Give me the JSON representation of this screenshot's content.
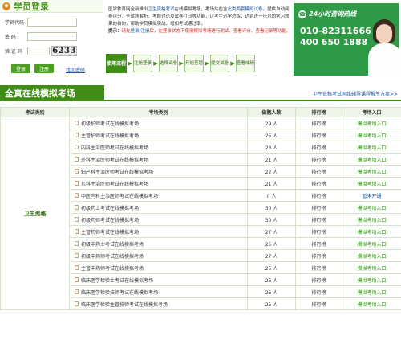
{
  "login": {
    "title": "学员登录",
    "code_label": "学员代码",
    "password_label": "密  码",
    "captcha_label": "验 证 码",
    "captcha_text": "6233",
    "login_button": "登录",
    "register_button": "注册",
    "forgot_link": "找回密码"
  },
  "intro": {
    "p1_a": "医学教育网全新推出",
    "p1_link": "卫生资格考试",
    "p1_b": "在线模拟考场，考场共包含",
    "p1_link2": "此类两套模拟试卷",
    "p1_c": "。提供自动阅卷评分、全试题解析、考题讨论及试卷打印等功能，让考生迅学边练，达到进一步巩固学习效果的目的，帮助学员模拟实战，增加考试通过率。",
    "tip_label": "提示：",
    "tip_a": "请先",
    "tip_link": "登录/注册",
    "tip_b": "后，在登录状态下使用模拟考场进行测试、查看评分、",
    "tip_c": "查看记录等功能。"
  },
  "flow": {
    "head": "使用流程",
    "steps": [
      "注册登录",
      "选择试卷",
      "开始答题",
      "提交试卷",
      "查看成绩"
    ],
    "arrow": "▶"
  },
  "hotline": {
    "phone_icon": "☎",
    "title": "24小时咨询热线",
    "number1": "010-82311666",
    "number2": "400 650 1888"
  },
  "section": {
    "title": "全真在线模拟考场",
    "more": "卫生资格考试网络辅导课程报生方案>>"
  },
  "table": {
    "headers": [
      "考试类别",
      "考场类别",
      "做题人数",
      "排行榜",
      "考场入口"
    ],
    "category": "卫生资格",
    "rows": [
      {
        "name": "初级护师考试在线模拟考场",
        "count": "29 人",
        "rank": "排行榜",
        "entry": "模拟考场入口"
      },
      {
        "name": "主管护师考试在线模拟考场",
        "count": "25 人",
        "rank": "排行榜",
        "entry": "模拟考场入口"
      },
      {
        "name": "内科主治医师考试在线模拟考场",
        "count": "23 人",
        "rank": "排行榜",
        "entry": "模拟考场入口"
      },
      {
        "name": "外科主治医师考试在线模拟考场",
        "count": "21 人",
        "rank": "排行榜",
        "entry": "模拟考场入口"
      },
      {
        "name": "妇产科主治医师考试在线模拟考场",
        "count": "22 人",
        "rank": "排行榜",
        "entry": "模拟考场入口"
      },
      {
        "name": "儿科主治医师考试在线模拟考场",
        "count": "21 人",
        "rank": "排行榜",
        "entry": "模拟考场入口"
      },
      {
        "name": "中医内科主治医师考试在线模拟考场",
        "count": "0 人",
        "rank": "排行榜",
        "entry": "暂未开通"
      },
      {
        "name": "初级药士考试在线模拟考场",
        "count": "30 人",
        "rank": "排行榜",
        "entry": "模拟考场入口"
      },
      {
        "name": "初级药师考试在线模拟考场",
        "count": "30 人",
        "rank": "排行榜",
        "entry": "模拟考场入口"
      },
      {
        "name": "主管药师考试在线模拟考场",
        "count": "27 人",
        "rank": "排行榜",
        "entry": "模拟考场入口"
      },
      {
        "name": "初级中药士考试在线模拟考场",
        "count": "25 人",
        "rank": "排行榜",
        "entry": "模拟考场入口"
      },
      {
        "name": "初级中药师考试在线模拟考场",
        "count": "27 人",
        "rank": "排行榜",
        "entry": "模拟考场入口"
      },
      {
        "name": "主管中药师考试在线模拟考场",
        "count": "25 人",
        "rank": "排行榜",
        "entry": "模拟考场入口"
      },
      {
        "name": "临床医学检验士考试在线模拟考场",
        "count": "25 人",
        "rank": "排行榜",
        "entry": "模拟考场入口"
      },
      {
        "name": "临床医学检验技师考试在线模拟考场",
        "count": "25 人",
        "rank": "排行榜",
        "entry": "模拟考场入口"
      },
      {
        "name": "临床医学检验主管技师考试在线模拟考场",
        "count": "25 人",
        "rank": "排行榜",
        "entry": "模拟考场入口"
      }
    ]
  }
}
